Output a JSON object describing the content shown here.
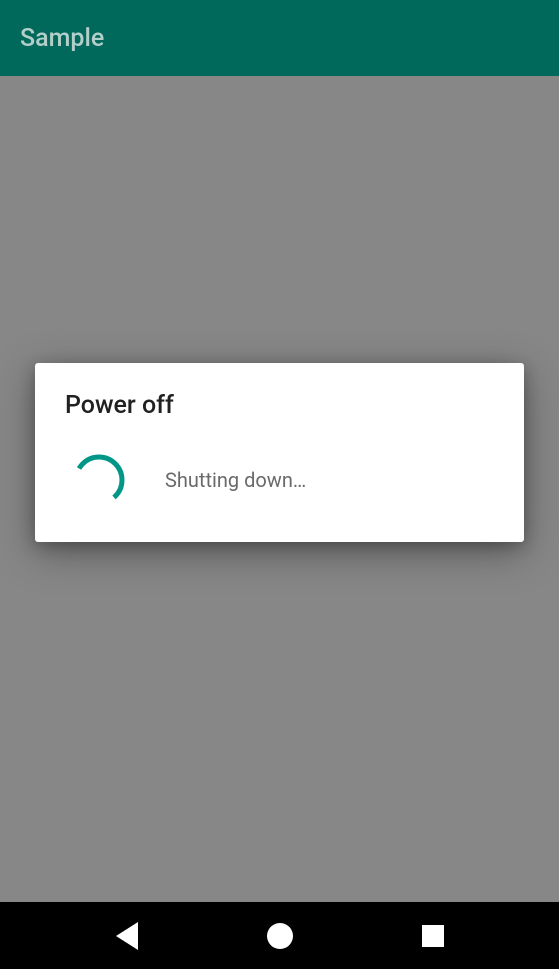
{
  "app_bar": {
    "title": "Sample"
  },
  "dialog": {
    "title": "Power off",
    "message": "Shutting down…"
  },
  "colors": {
    "primary": "#00695c",
    "accent": "#009688"
  }
}
